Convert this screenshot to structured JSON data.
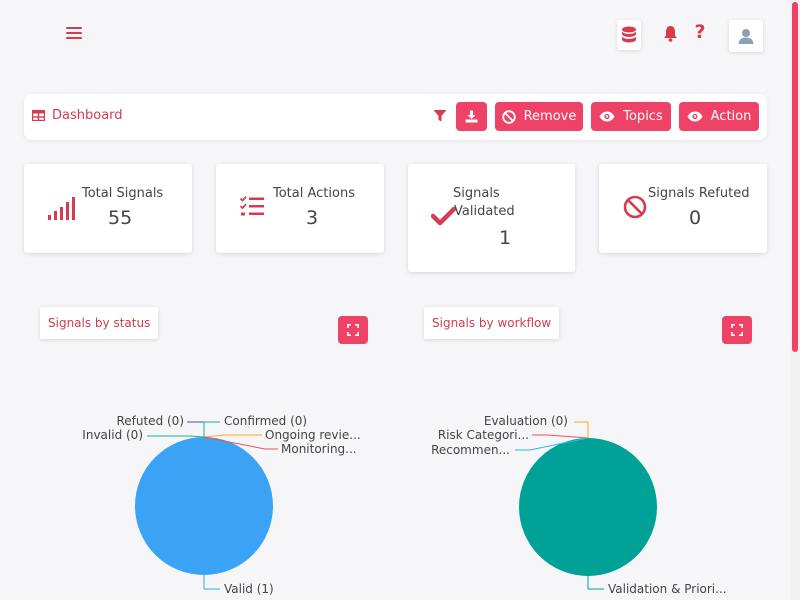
{
  "header": {
    "menu_icon": "hamburger-icon",
    "database_icon": "database-icon",
    "bell_icon": "bell-icon",
    "help_symbol": "?",
    "avatar_icon": "user-avatar-icon",
    "accent_color": "#ee4266"
  },
  "toolbar": {
    "title": "Dashboard",
    "filter_icon": "filter-icon",
    "download_icon": "download-icon",
    "remove_label": "Remove",
    "topics_label": "Topics",
    "action_label": "Action"
  },
  "stats": [
    {
      "label": "Total Signals",
      "value": "55",
      "icon": "signal-bars-icon"
    },
    {
      "label": "Total Actions",
      "value": "3",
      "icon": "checklist-icon"
    },
    {
      "label_line1": "Signals",
      "label_line2": "Validated",
      "value": "1",
      "icon": "checkmark-icon"
    },
    {
      "label": "Signals Refuted",
      "value": "0",
      "icon": "ban-icon"
    }
  ],
  "charts": {
    "status": {
      "title": "Signals by status",
      "labels": {
        "refuted": "Refuted (0)",
        "confirmed": "Confirmed (0)",
        "invalid": "Invalid (0)",
        "ongoing": "Ongoing revie...",
        "monitoring": "Monitoring...",
        "valid": "Valid (1)"
      },
      "color": "#3aa3f6"
    },
    "workflow": {
      "title": "Signals by workflow",
      "labels": {
        "evaluation": "Evaluation (0)",
        "risk": "Risk Categori...",
        "recommend": "Recommen...",
        "validation": "Validation & Priori..."
      },
      "color": "#00a196"
    }
  },
  "chart_data": [
    {
      "type": "pie",
      "title": "Signals by status",
      "categories": [
        "Refuted",
        "Confirmed",
        "Invalid",
        "Ongoing revie...",
        "Monitoring...",
        "Valid"
      ],
      "values": [
        0,
        0,
        0,
        null,
        null,
        1
      ],
      "colors": [
        "#3f51b5",
        "#26a69a",
        "#66bb6a",
        "#ffa726",
        "#ef5350",
        "#3aa3f6"
      ]
    },
    {
      "type": "pie",
      "title": "Signals by workflow",
      "categories": [
        "Evaluation",
        "Risk Categori...",
        "Recommen...",
        "Validation & Priori..."
      ],
      "values": [
        0,
        null,
        null,
        null
      ],
      "colors": [
        "#ffa726",
        "#ef5350",
        "#29b6f6",
        "#00a196"
      ]
    }
  ]
}
